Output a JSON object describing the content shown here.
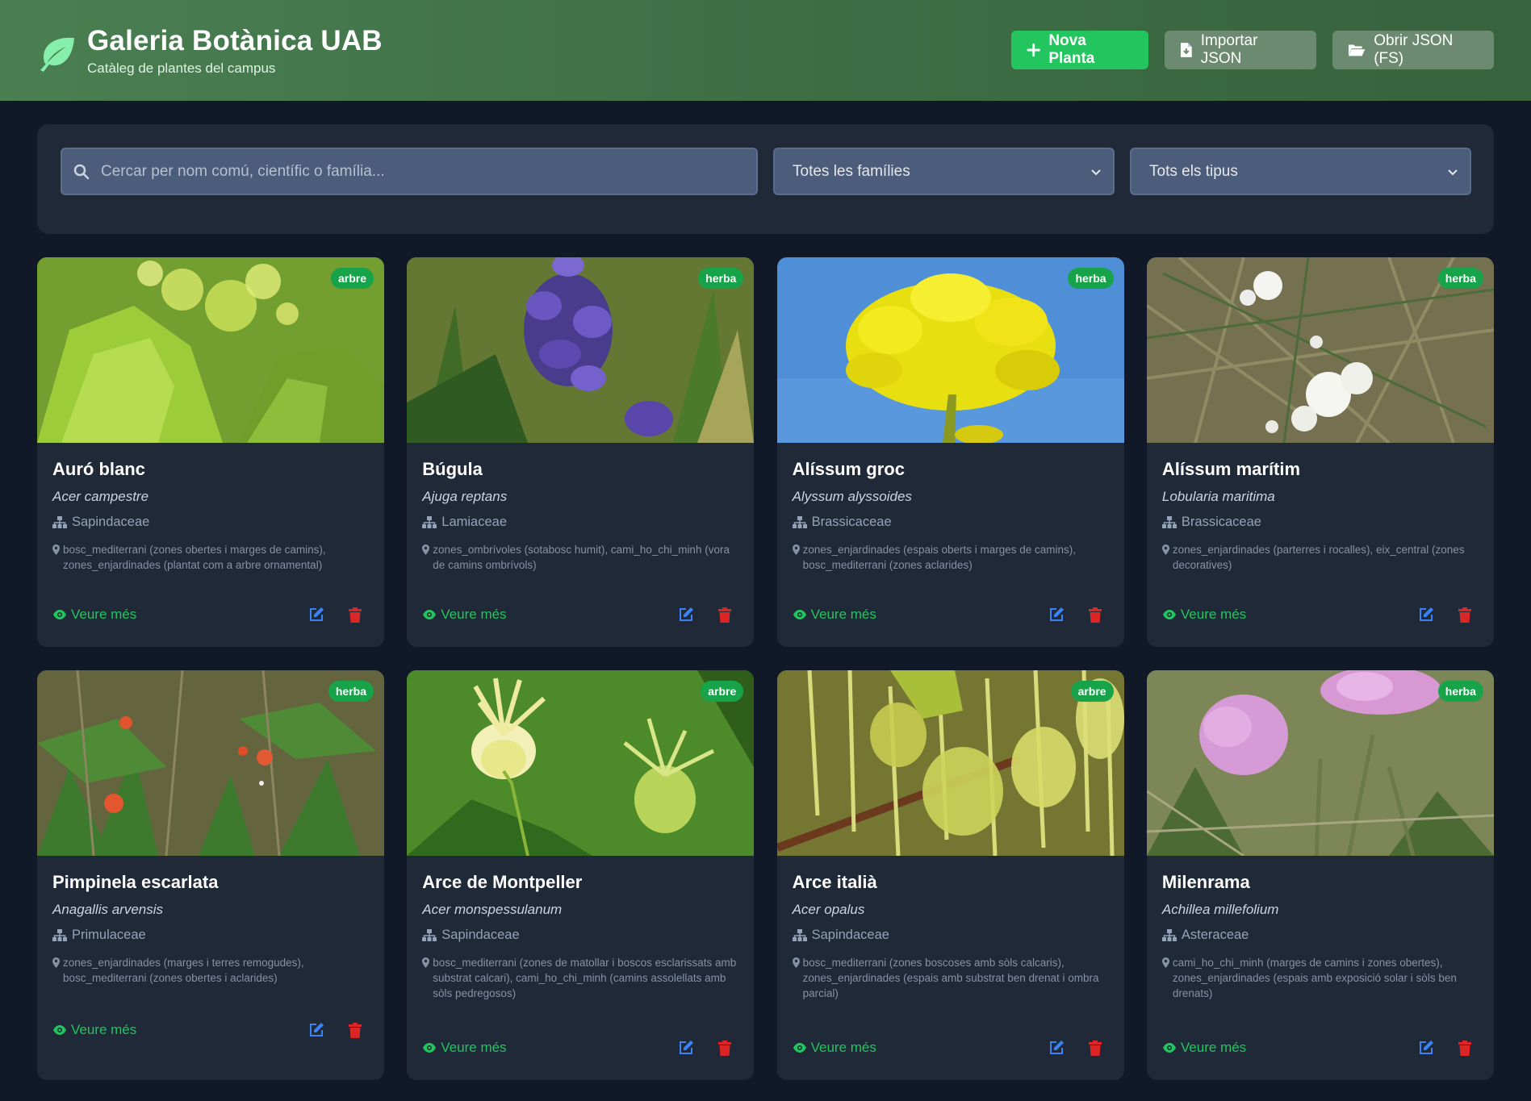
{
  "header": {
    "title": "Galeria Botànica UAB",
    "subtitle": "Catàleg de plantes del campus",
    "new_label": "Nova Planta",
    "import_label": "Importar JSON",
    "open_label": "Obrir JSON (FS)"
  },
  "filters": {
    "search_placeholder": "Cercar per nom comú, científic o família...",
    "family_selected": "Totes les famílies",
    "type_selected": "Tots els tipus"
  },
  "labels": {
    "more": "Veure més"
  },
  "colors": {
    "accent": "#22c55e",
    "header": "#3f6e45",
    "background": "#111827",
    "card": "#1f2937",
    "edit": "#3b82f6",
    "delete": "#dc2626"
  },
  "plants": [
    {
      "name": "Auró blanc",
      "scientific": "Acer campestre",
      "family": "Sapindaceae",
      "type": "arbre",
      "location": "bosc_mediterrani (zones obertes i marges de camins), zones_enjardinades (plantat com a arbre ornamental)"
    },
    {
      "name": "Búgula",
      "scientific": "Ajuga reptans",
      "family": "Lamiaceae",
      "type": "herba",
      "location": "zones_ombrívoles (sotabosc humit), cami_ho_chi_minh (vora de camins ombrívols)"
    },
    {
      "name": "Alíssum groc",
      "scientific": "Alyssum alyssoides",
      "family": "Brassicaceae",
      "type": "herba",
      "location": "zones_enjardinades (espais oberts i marges de camins), bosc_mediterrani (zones aclarides)"
    },
    {
      "name": "Alíssum marítim",
      "scientific": "Lobularia maritima",
      "family": "Brassicaceae",
      "type": "herba",
      "location": "zones_enjardinades (parterres i rocalles), eix_central (zones decoratives)"
    },
    {
      "name": "Pimpinela escarlata",
      "scientific": "Anagallis arvensis",
      "family": "Primulaceae",
      "type": "herba",
      "location": "zones_enjardinades (marges i terres remogudes), bosc_mediterrani (zones obertes i aclarides)"
    },
    {
      "name": "Arce de Montpeller",
      "scientific": "Acer monspessulanum",
      "family": "Sapindaceae",
      "type": "arbre",
      "location": "bosc_mediterrani (zones de matollar i boscos esclarissats amb substrat calcari), cami_ho_chi_minh (camins assolellats amb sòls pedregosos)"
    },
    {
      "name": "Arce italià",
      "scientific": "Acer opalus",
      "family": "Sapindaceae",
      "type": "arbre",
      "location": "bosc_mediterrani (zones boscoses amb sòls calcaris), zones_enjardinades (espais amb substrat ben drenat i ombra parcial)"
    },
    {
      "name": "Milenrama",
      "scientific": "Achillea millefolium",
      "family": "Asteraceae",
      "type": "herba",
      "location": "cami_ho_chi_minh (marges de camins i zones obertes), zones_enjardinades (espais amb exposició solar i sòls ben drenats)"
    }
  ]
}
